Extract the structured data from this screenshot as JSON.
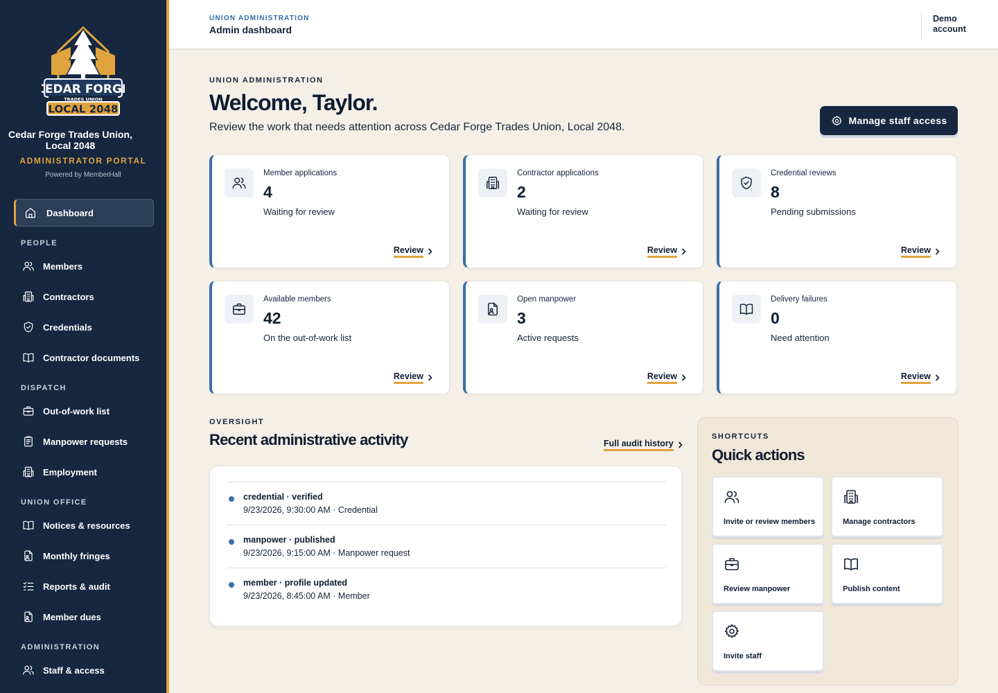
{
  "sidebar": {
    "logo": {
      "line1": "CEDAR FORGE",
      "line2": "TRADES UNION",
      "line3": "LOCAL 2048"
    },
    "org_name": "Cedar Forge Trades Union, Local 2048",
    "portal_label": "ADMINISTRATOR PORTAL",
    "powered_by": "Powered by MemberHall",
    "dashboard_label": "Dashboard",
    "sections": {
      "people": "PEOPLE",
      "dispatch": "DISPATCH",
      "union_office": "UNION OFFICE",
      "administration": "ADMINISTRATION"
    },
    "items": {
      "members": "Members",
      "contractors": "Contractors",
      "credentials": "Credentials",
      "contractor_documents": "Contractor documents",
      "out_of_work": "Out-of-work list",
      "manpower_requests": "Manpower requests",
      "employment": "Employment",
      "notices": "Notices & resources",
      "monthly_fringes": "Monthly fringes",
      "reports": "Reports & audit",
      "member_dues": "Member dues",
      "staff_access": "Staff & access"
    }
  },
  "topbar": {
    "kicker": "UNION ADMINISTRATION",
    "title": "Admin dashboard",
    "account_line1": "Demo",
    "account_line2": "account"
  },
  "main": {
    "kicker": "UNION ADMINISTRATION",
    "welcome": "Welcome, Taylor.",
    "subtitle": "Review the work that needs attention across Cedar Forge Trades Union, Local 2048.",
    "manage_button": "Manage staff access",
    "review_label": "Review",
    "cards": [
      {
        "label": "Member applications",
        "value": "4",
        "desc": "Waiting for review",
        "icon": "users-icon"
      },
      {
        "label": "Contractor applications",
        "value": "2",
        "desc": "Waiting for review",
        "icon": "building-icon"
      },
      {
        "label": "Credential reviews",
        "value": "8",
        "desc": "Pending submissions",
        "icon": "shield-check-icon"
      },
      {
        "label": "Available members",
        "value": "42",
        "desc": "On the out-of-work list",
        "icon": "briefcase-icon"
      },
      {
        "label": "Open manpower",
        "value": "3",
        "desc": "Active requests",
        "icon": "file-user-icon"
      },
      {
        "label": "Delivery failures",
        "value": "0",
        "desc": "Need attention",
        "icon": "book-open-icon"
      }
    ]
  },
  "oversight": {
    "kicker": "OVERSIGHT",
    "title": "Recent administrative activity",
    "audit_link": "Full audit history",
    "items": [
      {
        "title": "credential · verified",
        "meta": "9/23/2026, 9:30:00 AM · Credential"
      },
      {
        "title": "manpower · published",
        "meta": "9/23/2026, 9:15:00 AM · Manpower request"
      },
      {
        "title": "member · profile updated",
        "meta": "9/23/2026, 8:45:00 AM · Member"
      }
    ]
  },
  "shortcuts": {
    "kicker": "SHORTCUTS",
    "title": "Quick actions",
    "items": [
      {
        "label": "Invite or review members",
        "icon": "users-icon"
      },
      {
        "label": "Manage contractors",
        "icon": "building-icon"
      },
      {
        "label": "Review manpower",
        "icon": "briefcase-icon"
      },
      {
        "label": "Publish content",
        "icon": "book-open-icon"
      },
      {
        "label": "Invite staff",
        "icon": "gear-icon"
      }
    ]
  },
  "colors": {
    "navy": "#16273f",
    "accent": "#e1a33d",
    "blue": "#3a6fa8",
    "background": "#f4f0e8"
  }
}
